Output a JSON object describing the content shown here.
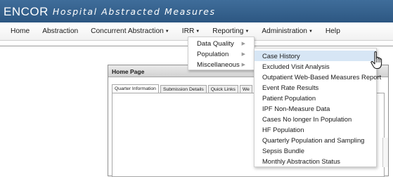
{
  "header": {
    "logo": "ENCOR",
    "app_title": "Hospital Abstracted Measures"
  },
  "nav": {
    "items": [
      {
        "label": "Home",
        "has_caret": false
      },
      {
        "label": "Abstraction",
        "has_caret": false
      },
      {
        "label": "Concurrent Abstraction",
        "has_caret": true
      },
      {
        "label": "IRR",
        "has_caret": true
      },
      {
        "label": "Reporting",
        "has_caret": true
      },
      {
        "label": "Administration",
        "has_caret": true
      },
      {
        "label": "Help",
        "has_caret": false
      }
    ]
  },
  "reporting_menu": {
    "items": [
      {
        "label": "Data Quality",
        "has_submenu": true
      },
      {
        "label": "Population",
        "has_submenu": true
      },
      {
        "label": "Miscellaneous",
        "has_submenu": true
      }
    ]
  },
  "population_submenu": {
    "hovered_index": 0,
    "items": [
      "Case History",
      "Excluded Visit Analysis",
      "Outpatient Web-Based Measures Report",
      "Event Rate Results",
      "Patient Population",
      "IPF Non-Measure Data",
      "Cases No longer In Population",
      "HF Population",
      "Quarterly Population and Sampling",
      "Sepsis Bundle",
      "Monthly Abstraction Status"
    ]
  },
  "home_panel": {
    "title": "Home Page",
    "tabs": [
      "Quarter Information",
      "Submission Details",
      "Quick Links",
      "We"
    ]
  },
  "colors": {
    "header": "#2d5782",
    "hover": "#d7e6f5"
  },
  "icons": {
    "caret": "caret-down-icon",
    "submenu_arrow": "chevron-right-icon",
    "cursor": "hand-pointer-icon"
  }
}
